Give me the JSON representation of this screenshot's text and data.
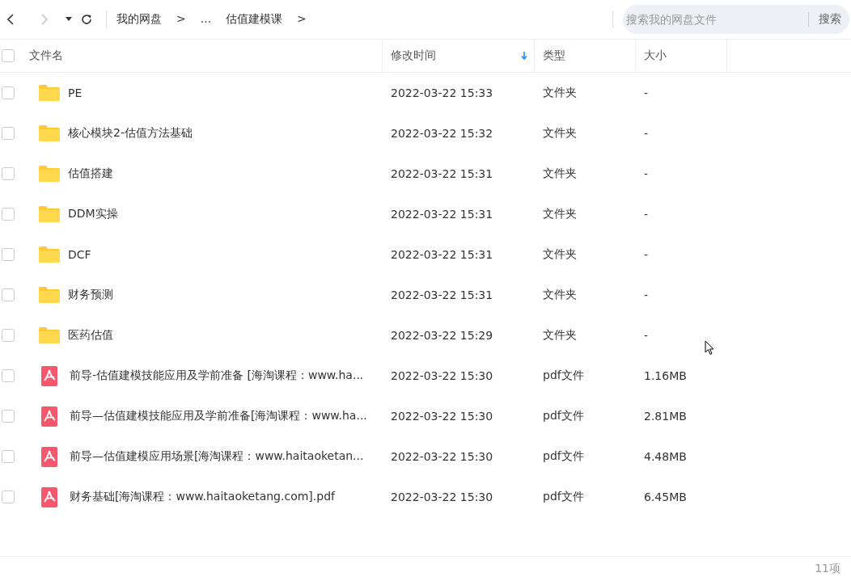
{
  "breadcrumb": [
    "我的网盘",
    ">",
    "...",
    "估值建模课",
    ">"
  ],
  "search": {
    "placeholder": "搜索我的网盘文件",
    "button": "搜索"
  },
  "table": {
    "columns": [
      {
        "label": "文件名",
        "sorted": false
      },
      {
        "label": "修改时间",
        "sorted": true
      },
      {
        "label": "类型",
        "sorted": false
      },
      {
        "label": "大小",
        "sorted": false
      }
    ],
    "select_all": {
      "checked": false
    },
    "rows": [
      {
        "kind": "folder",
        "name": "PE",
        "modified": "2022-03-22 15:33",
        "type": "文件夹",
        "size": "-",
        "checked": false
      },
      {
        "kind": "folder",
        "name": "核心模块2-估值方法基础",
        "modified": "2022-03-22 15:32",
        "type": "文件夹",
        "size": "-",
        "checked": false
      },
      {
        "kind": "folder",
        "name": "估值搭建",
        "modified": "2022-03-22 15:31",
        "type": "文件夹",
        "size": "-",
        "checked": false
      },
      {
        "kind": "folder",
        "name": "DDM实操",
        "modified": "2022-03-22 15:31",
        "type": "文件夹",
        "size": "-",
        "checked": false
      },
      {
        "kind": "folder",
        "name": "DCF",
        "modified": "2022-03-22 15:31",
        "type": "文件夹",
        "size": "-",
        "checked": false
      },
      {
        "kind": "folder",
        "name": "财务预测",
        "modified": "2022-03-22 15:31",
        "type": "文件夹",
        "size": "-",
        "checked": false
      },
      {
        "kind": "folder",
        "name": "医药估值",
        "modified": "2022-03-22 15:29",
        "type": "文件夹",
        "size": "-",
        "checked": false
      },
      {
        "kind": "pdf",
        "name": "前导-估值建模技能应用及学前准备  [海淘课程：www.ha...",
        "modified": "2022-03-22 15:30",
        "type": "pdf文件",
        "size": "1.16MB",
        "checked": false
      },
      {
        "kind": "pdf",
        "name": "前导—估值建模技能应用及学前准备[海淘课程：www.ha...",
        "modified": "2022-03-22 15:30",
        "type": "pdf文件",
        "size": "2.81MB",
        "checked": false
      },
      {
        "kind": "pdf",
        "name": "前导—估值建模应用场景[海淘课程：www.haitaoketan...",
        "modified": "2022-03-22 15:30",
        "type": "pdf文件",
        "size": "4.48MB",
        "checked": false
      },
      {
        "kind": "pdf",
        "name": "财务基础[海淘课程：www.haitaoketang.com].pdf",
        "modified": "2022-03-22 15:30",
        "type": "pdf文件",
        "size": "6.45MB",
        "checked": false
      }
    ]
  },
  "status_bar": {
    "count": "11项"
  }
}
